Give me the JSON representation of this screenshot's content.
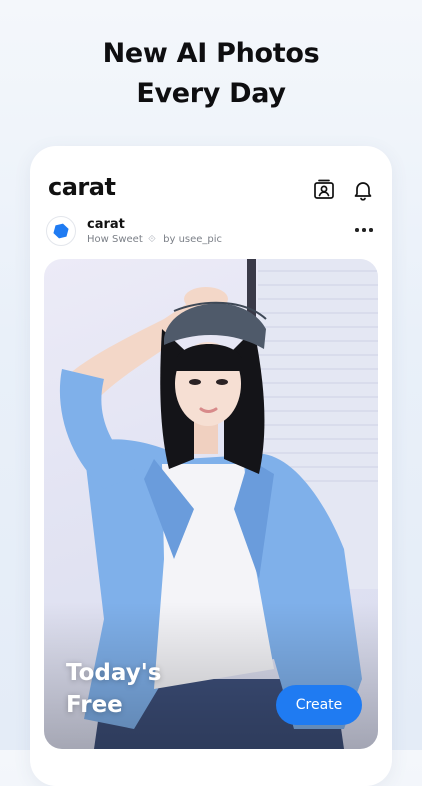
{
  "headline": {
    "line1": "New AI Photos",
    "line2": "Every Day"
  },
  "app": {
    "logo": "carat"
  },
  "top_icons": [
    "profile-card-icon",
    "bell-icon"
  ],
  "post": {
    "account_name": "carat",
    "style_name": "How Sweet",
    "by_text": "by usee_pic",
    "more_icon": "more-icon"
  },
  "photo": {
    "label_line1": "Today's",
    "label_line2": "Free",
    "create_label": "Create"
  },
  "colors": {
    "accent": "#1f7bf2",
    "shirt": "#7fb0ea",
    "background": "#e9f0f9"
  }
}
